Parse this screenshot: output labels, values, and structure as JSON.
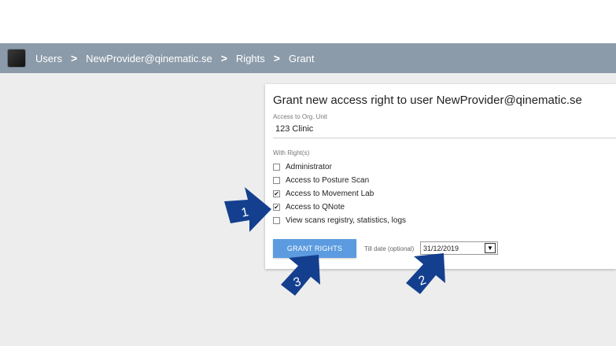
{
  "breadcrumb": {
    "items": [
      "Users",
      "NewProvider@qinematic.se",
      "Rights",
      "Grant"
    ],
    "separator": ">"
  },
  "panel": {
    "title": "Grant new access right to user NewProvider@qinematic.se",
    "org_unit_label": "Access to Org. Unit",
    "org_unit_value": "123 Clinic",
    "rights_label": "With Right(s)",
    "rights": [
      {
        "label": "Administrator",
        "checked": false
      },
      {
        "label": "Access to Posture Scan",
        "checked": false
      },
      {
        "label": "Access to Movement Lab",
        "checked": true
      },
      {
        "label": "Access to QNote",
        "checked": true
      },
      {
        "label": "View scans registry, statistics, logs",
        "checked": false
      }
    ],
    "grant_button": "GRANT RIGHTS",
    "till_date_label": "Till date (optional)",
    "till_date_value": "31/12/2019",
    "date_dropdown_icon": "▼"
  },
  "annotations": [
    "1",
    "2",
    "3"
  ],
  "colors": {
    "breadcrumb_bar": "#8c9baa",
    "button": "#5c9be0",
    "arrow": "#143f8f"
  }
}
